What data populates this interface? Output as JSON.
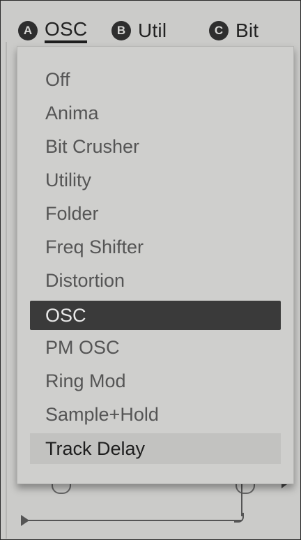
{
  "tabs": [
    {
      "badge": "A",
      "label": "OSC",
      "active": true
    },
    {
      "badge": "B",
      "label": "Util",
      "active": false
    },
    {
      "badge": "C",
      "label": "Bit",
      "active": false
    }
  ],
  "dropdown": {
    "items": [
      {
        "label": "Off",
        "state": "normal"
      },
      {
        "label": "Anima",
        "state": "normal"
      },
      {
        "label": "Bit Crusher",
        "state": "normal"
      },
      {
        "label": "Utility",
        "state": "normal"
      },
      {
        "label": "Folder",
        "state": "normal"
      },
      {
        "label": "Freq Shifter",
        "state": "normal"
      },
      {
        "label": "Distortion",
        "state": "normal"
      },
      {
        "label": "OSC",
        "state": "selected"
      },
      {
        "label": "PM OSC",
        "state": "normal"
      },
      {
        "label": "Ring Mod",
        "state": "normal"
      },
      {
        "label": "Sample+Hold",
        "state": "normal"
      },
      {
        "label": "Track Delay",
        "state": "hover"
      }
    ]
  },
  "colors": {
    "background": "#cbcbc9",
    "selected_bg": "#3a3a3a",
    "hover_bg": "#c2c2c0",
    "badge_bg": "#2e2e2e"
  }
}
